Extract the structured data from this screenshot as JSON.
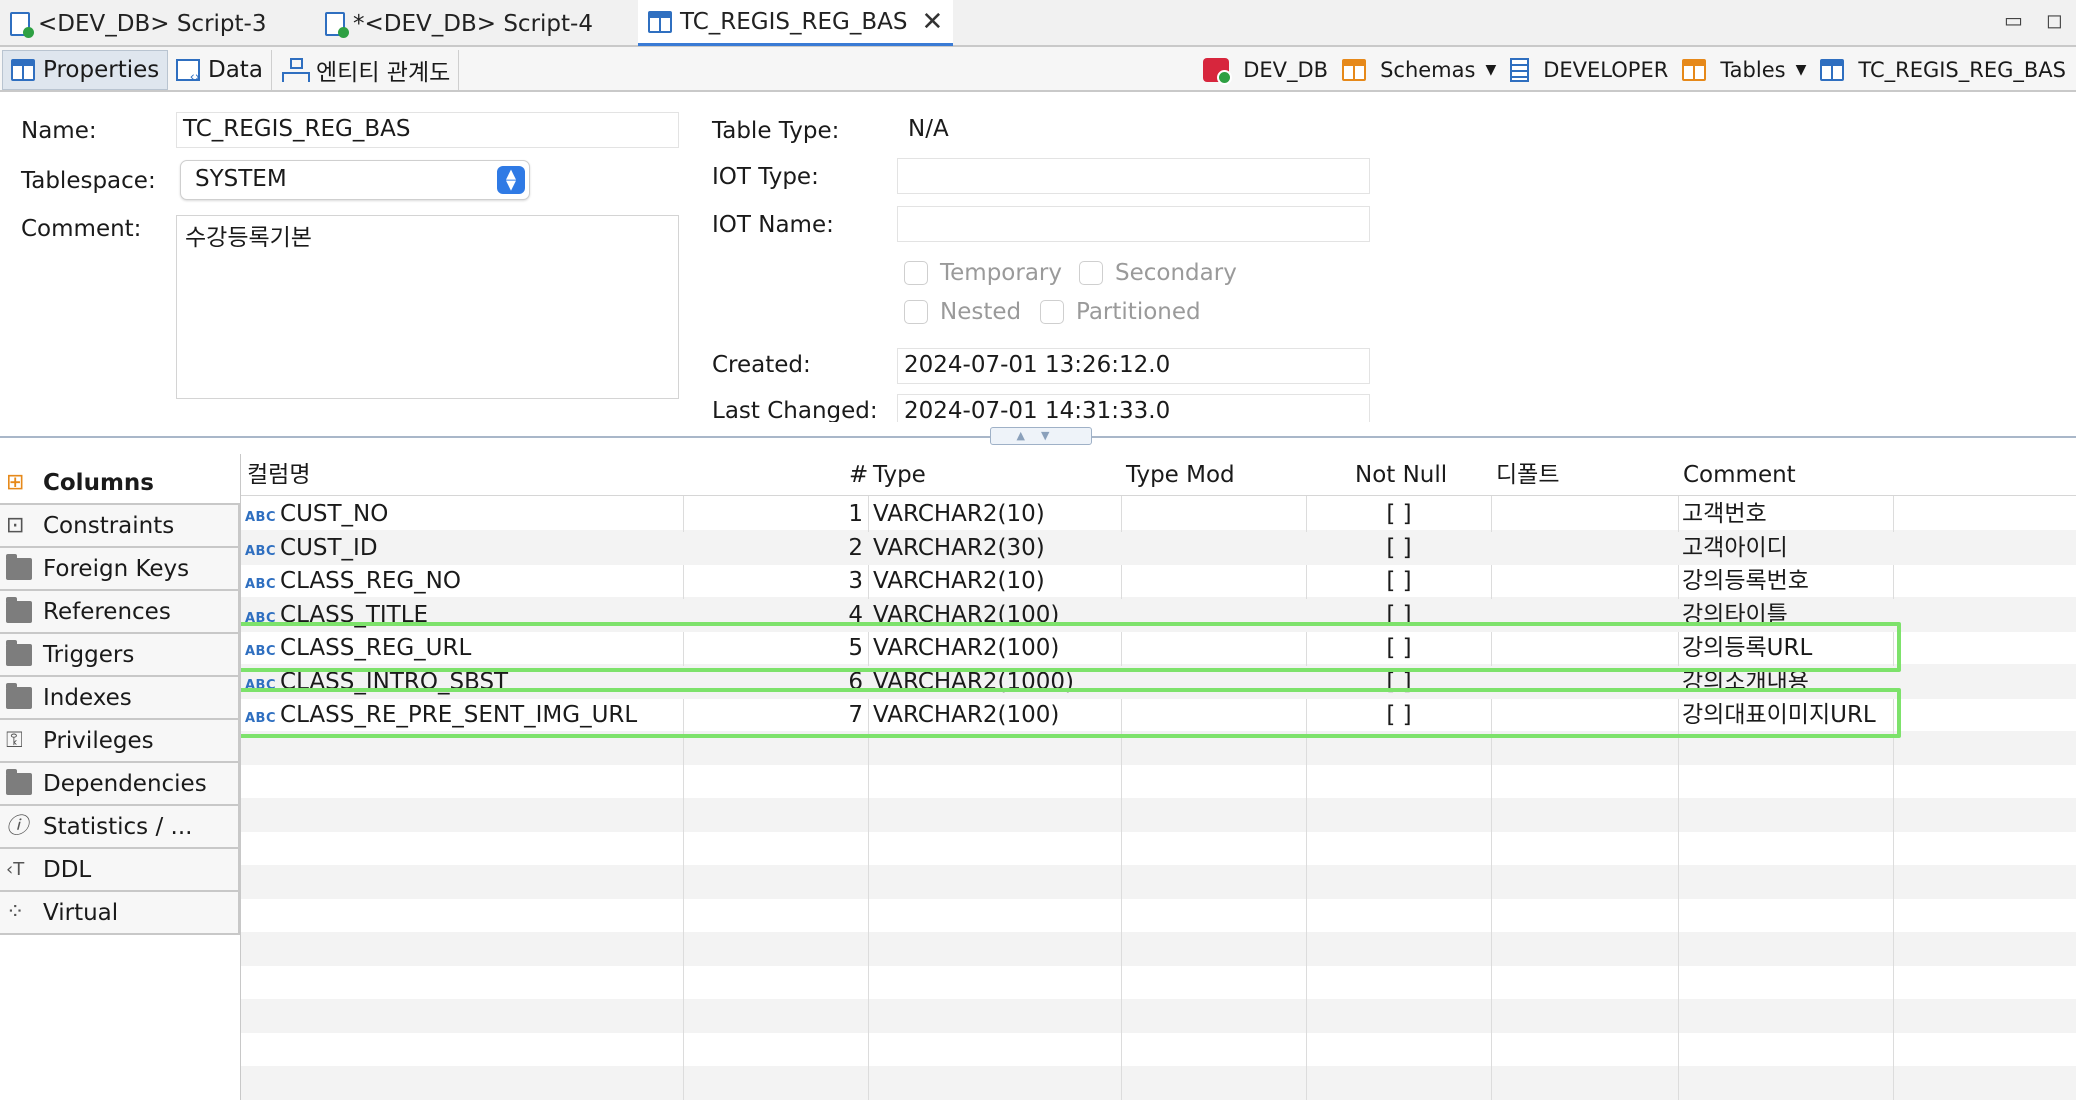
{
  "editor_tabs": [
    {
      "label": "<DEV_DB> Script-3",
      "icon": "sql-script-icon"
    },
    {
      "label": "*<DEV_DB> Script-4",
      "icon": "sql-script-icon"
    },
    {
      "label": "TC_REGIS_REG_BAS",
      "icon": "table-icon"
    }
  ],
  "sub_tabs": [
    {
      "label": "Properties",
      "icon": "table-icon"
    },
    {
      "label": "Data",
      "icon": "data-icon"
    },
    {
      "label": "엔티티 관계도",
      "icon": "er-diagram-icon"
    }
  ],
  "breadcrumbs": [
    {
      "label": "DEV_DB",
      "icon": "database-connection-icon"
    },
    {
      "label": "Schemas",
      "icon": "schemas-folder-icon"
    },
    {
      "label": "DEVELOPER",
      "icon": "schema-icon"
    },
    {
      "label": "Tables",
      "icon": "tables-folder-icon"
    },
    {
      "label": "TC_REGIS_REG_BAS",
      "icon": "table-icon"
    }
  ],
  "form": {
    "name_label": "Name:",
    "name_value": "TC_REGIS_REG_BAS",
    "tablespace_label": "Tablespace:",
    "tablespace_value": "SYSTEM",
    "comment_label": "Comment:",
    "comment_value": "수강등록기본",
    "table_type_label": "Table Type:",
    "table_type_value": "N/A",
    "iot_type_label": "IOT Type:",
    "iot_type_value": "",
    "iot_name_label": "IOT Name:",
    "iot_name_value": "",
    "temporary_label": "Temporary",
    "secondary_label": "Secondary",
    "nested_label": "Nested",
    "partitioned_label": "Partitioned",
    "created_label": "Created:",
    "created_value": "2024-07-01 13:26:12.0",
    "last_changed_label": "Last Changed:",
    "last_changed_value": "2024-07-01 14:31:33.0"
  },
  "sections": [
    {
      "label": "Columns",
      "icon": "columns-icon"
    },
    {
      "label": "Constraints",
      "icon": "constraints-icon"
    },
    {
      "label": "Foreign Keys",
      "icon": "folder-icon"
    },
    {
      "label": "References",
      "icon": "folder-icon"
    },
    {
      "label": "Triggers",
      "icon": "folder-icon"
    },
    {
      "label": "Indexes",
      "icon": "folder-icon"
    },
    {
      "label": "Privileges",
      "icon": "privileges-icon"
    },
    {
      "label": "Dependencies",
      "icon": "folder-icon"
    },
    {
      "label": "Statistics / ...",
      "icon": "info-icon"
    },
    {
      "label": "DDL",
      "icon": "ddl-icon"
    },
    {
      "label": "Virtual",
      "icon": "virtual-icon"
    }
  ],
  "columns_table": {
    "headers": [
      "컬럼명",
      "#",
      "Type",
      "Type Mod",
      "Not Null",
      "디폴트",
      "Comment"
    ],
    "type_badge": "ABC",
    "rows": [
      {
        "name": "CUST_NO",
        "num": "1",
        "type": "VARCHAR2(10)",
        "type_mod": "",
        "not_null": "[ ]",
        "default": "",
        "comment": "고객번호"
      },
      {
        "name": "CUST_ID",
        "num": "2",
        "type": "VARCHAR2(30)",
        "type_mod": "",
        "not_null": "[ ]",
        "default": "",
        "comment": "고객아이디"
      },
      {
        "name": "CLASS_REG_NO",
        "num": "3",
        "type": "VARCHAR2(10)",
        "type_mod": "",
        "not_null": "[ ]",
        "default": "",
        "comment": "강의등록번호"
      },
      {
        "name": "CLASS_TITLE",
        "num": "4",
        "type": "VARCHAR2(100)",
        "type_mod": "",
        "not_null": "[ ]",
        "default": "",
        "comment": "강의타이틀"
      },
      {
        "name": "CLASS_REG_URL",
        "num": "5",
        "type": "VARCHAR2(100)",
        "type_mod": "",
        "not_null": "[ ]",
        "default": "",
        "comment": "강의등록URL"
      },
      {
        "name": "CLASS_INTRO_SBST",
        "num": "6",
        "type": "VARCHAR2(1000)",
        "type_mod": "",
        "not_null": "[ ]",
        "default": "",
        "comment": "강의소개내용"
      },
      {
        "name": "CLASS_RE_PRE_SENT_IMG_URL",
        "num": "7",
        "type": "VARCHAR2(100)",
        "type_mod": "",
        "not_null": "[ ]",
        "default": "",
        "comment": "강의대표이미지URL"
      }
    ]
  },
  "colors": {
    "accent": "#3a7bd5",
    "highlight_box": "#7de26b",
    "type_badge": "#2f6fc0"
  }
}
